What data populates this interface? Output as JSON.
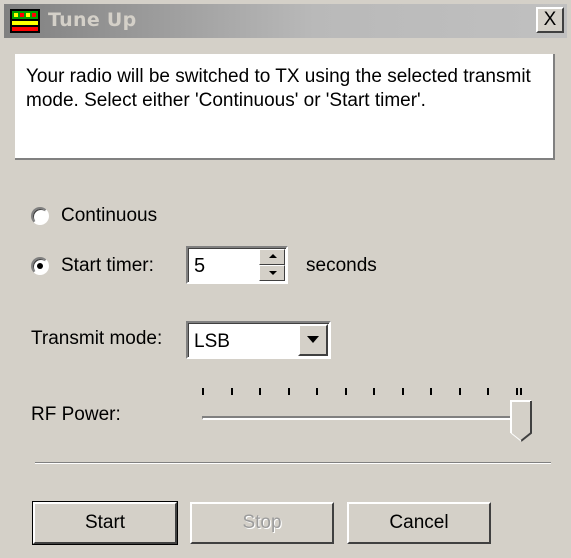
{
  "window": {
    "title": "Tune Up",
    "close_label": "X",
    "icon": "app-icon"
  },
  "info": {
    "text": "Your radio will be switched to TX using the selected transmit mode. Select either 'Continuous' or 'Start timer'."
  },
  "mode_options": {
    "continuous_label": "Continuous",
    "continuous_selected": false,
    "start_timer_label": "Start timer:",
    "start_timer_selected": true
  },
  "timer": {
    "value": "5",
    "unit_label": "seconds"
  },
  "transmit_mode": {
    "label": "Transmit mode:",
    "selected": "LSB"
  },
  "rf_power": {
    "label": "RF Power:",
    "tick_count": 12,
    "level_fraction": 1.0
  },
  "buttons": {
    "start_label": "Start",
    "stop_label": "Stop",
    "stop_enabled": false,
    "cancel_label": "Cancel"
  },
  "colors": {
    "dialog_bg": "#d4d0c8",
    "title_gradient_start": "#808080",
    "title_gradient_end": "#c0c0c0",
    "disabled_text": "#9c9c9c"
  }
}
